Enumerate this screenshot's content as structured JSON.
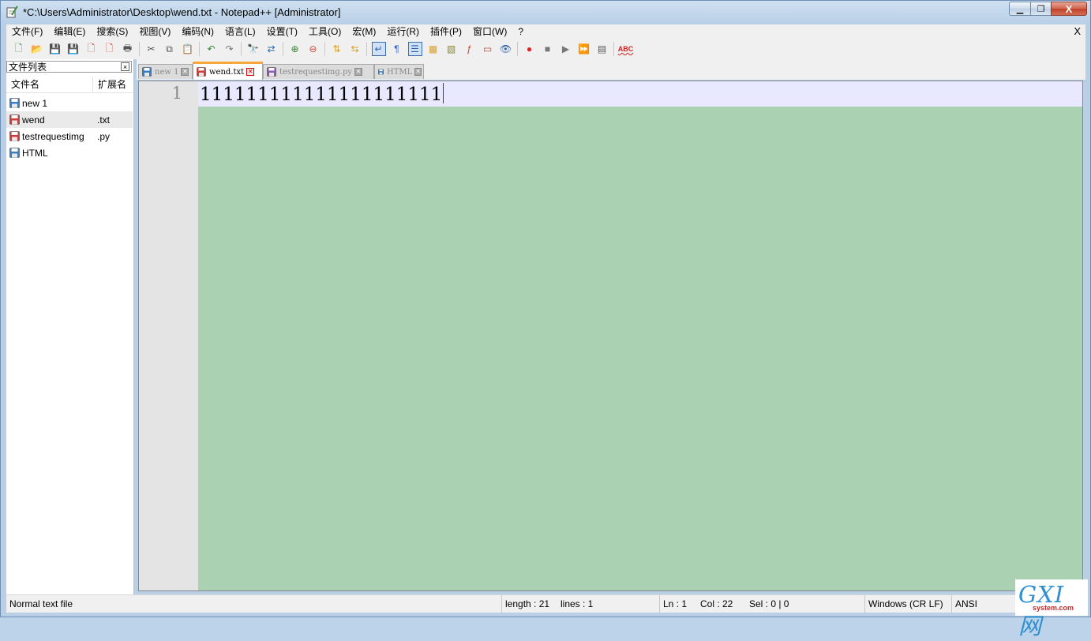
{
  "window": {
    "title": "*C:\\Users\\Administrator\\Desktop\\wend.txt - Notepad++ [Administrator]",
    "controls": {
      "minimize": "▁",
      "maximize": "❐",
      "close": "X"
    }
  },
  "menubar": {
    "items": [
      "文件(F)",
      "编辑(E)",
      "搜索(S)",
      "视图(V)",
      "编码(N)",
      "语言(L)",
      "设置(T)",
      "工具(O)",
      "宏(M)",
      "运行(R)",
      "插件(P)",
      "窗口(W)",
      "?"
    ],
    "close": "X"
  },
  "toolbar": {
    "icons": [
      {
        "name": "new-file-icon",
        "glyph": "🗋",
        "color": "#3a8a3a"
      },
      {
        "name": "open-file-icon",
        "glyph": "📂",
        "color": "#d9a12a"
      },
      {
        "name": "save-icon",
        "glyph": "💾",
        "color": "#2a5fb0"
      },
      {
        "name": "save-all-icon",
        "glyph": "💾",
        "color": "#2a5fb0"
      },
      {
        "name": "close-file-icon",
        "glyph": "🗋",
        "color": "#c43"
      },
      {
        "name": "close-all-icon",
        "glyph": "🗋",
        "color": "#c43"
      },
      {
        "name": "print-icon",
        "glyph": "🖶",
        "color": "#555"
      },
      {
        "sep": true
      },
      {
        "name": "cut-icon",
        "glyph": "✂",
        "color": "#555"
      },
      {
        "name": "copy-icon",
        "glyph": "⧉",
        "color": "#555"
      },
      {
        "name": "paste-icon",
        "glyph": "📋",
        "color": "#8a6a2a"
      },
      {
        "sep": true
      },
      {
        "name": "undo-icon",
        "glyph": "↶",
        "color": "#2a8a2a"
      },
      {
        "name": "redo-icon",
        "glyph": "↷",
        "color": "#777"
      },
      {
        "sep": true
      },
      {
        "name": "find-icon",
        "glyph": "🔭",
        "color": "#333"
      },
      {
        "name": "replace-icon",
        "glyph": "⇄",
        "color": "#2a6ab0"
      },
      {
        "sep": true
      },
      {
        "name": "zoom-in-icon",
        "glyph": "⊕",
        "color": "#2a8a2a"
      },
      {
        "name": "zoom-out-icon",
        "glyph": "⊖",
        "color": "#c43"
      },
      {
        "sep": true
      },
      {
        "name": "sync-vertical-icon",
        "glyph": "⇅",
        "color": "#d9a12a"
      },
      {
        "name": "sync-horizontal-icon",
        "glyph": "⇆",
        "color": "#d9a12a"
      },
      {
        "sep": true
      },
      {
        "name": "word-wrap-icon",
        "glyph": "↵",
        "color": "#2a5fb0",
        "active": true
      },
      {
        "name": "show-all-chars-icon",
        "glyph": "¶",
        "color": "#2a5fb0"
      },
      {
        "name": "indent-guide-icon",
        "glyph": "☰",
        "color": "#2a5fb0",
        "active": true
      },
      {
        "name": "language-icon",
        "glyph": "▦",
        "color": "#d9a12a"
      },
      {
        "name": "doc-map-icon",
        "glyph": "▧",
        "color": "#8a8a2a"
      },
      {
        "name": "function-list-icon",
        "glyph": "ƒ",
        "color": "#c43"
      },
      {
        "name": "folder-workspace-icon",
        "glyph": "▭",
        "color": "#c43"
      },
      {
        "name": "monitoring-icon",
        "glyph": "👁",
        "color": "#2a5fb0"
      },
      {
        "sep": true
      },
      {
        "name": "record-macro-icon",
        "glyph": "●",
        "color": "#d22"
      },
      {
        "name": "stop-macro-icon",
        "glyph": "■",
        "color": "#777"
      },
      {
        "name": "play-macro-icon",
        "glyph": "▶",
        "color": "#777"
      },
      {
        "name": "run-macro-multiple-icon",
        "glyph": "⏩",
        "color": "#2a5fb0"
      },
      {
        "name": "save-macro-icon",
        "glyph": "▤",
        "color": "#555"
      },
      {
        "sep": true
      },
      {
        "name": "spell-check-icon",
        "glyph": "ABC",
        "color": "#c22"
      }
    ]
  },
  "sidebar": {
    "title": "文件列表",
    "close": "×",
    "columns": {
      "name": "文件名",
      "ext": "扩展名"
    },
    "files": [
      {
        "name": "new 1",
        "ext": "",
        "color": "#3b7dc4",
        "selected": false
      },
      {
        "name": "wend",
        "ext": ".txt",
        "color": "#d33a3a",
        "selected": true
      },
      {
        "name": "testrequestimg",
        "ext": ".py",
        "color": "#d33a3a",
        "selected": false
      },
      {
        "name": "HTML",
        "ext": "",
        "color": "#3b7dc4",
        "selected": false
      }
    ]
  },
  "tabs": [
    {
      "label": "new 1",
      "color": "#3b7dc4",
      "active": false
    },
    {
      "label": "wend.txt",
      "color": "#d33a3a",
      "active": true
    },
    {
      "label": "testrequestimg.py",
      "color": "#8a5ab0",
      "active": false
    },
    {
      "label": "HTML",
      "color": "#3b7dc4",
      "active": false
    }
  ],
  "editor": {
    "line_number": "1",
    "content": "111111111111111111111"
  },
  "statusbar": {
    "file_type": "Normal text file",
    "length": "length : 21",
    "lines": "lines : 1",
    "ln": "Ln : 1",
    "col": "Col : 22",
    "sel": "Sel : 0 | 0",
    "eol": "Windows (CR LF)",
    "encoding": "ANSI"
  },
  "watermark": {
    "logo": "GXI网",
    "site": "system.com"
  }
}
